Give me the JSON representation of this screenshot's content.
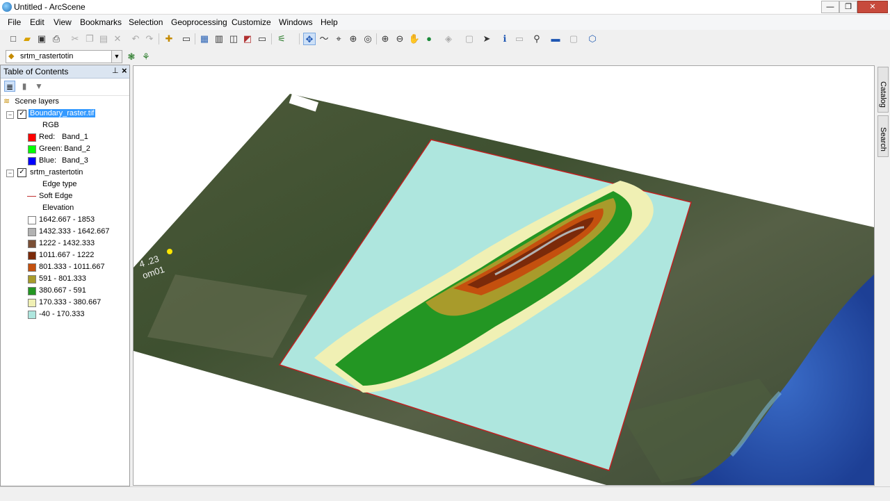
{
  "window": {
    "title": "Untitled - ArcScene",
    "minimize": "—",
    "maximize": "❐",
    "close": "✕"
  },
  "menu": [
    "File",
    "Edit",
    "View",
    "Bookmarks",
    "Selection",
    "Geoprocessing",
    "Customize",
    "Windows",
    "Help"
  ],
  "layer_dropdown": {
    "value": "srtm_rastertotin"
  },
  "toc": {
    "title": "Table of Contents",
    "group": "Scene layers",
    "layer1": {
      "name": "Boundary_raster.tif",
      "render": "RGB",
      "bands": [
        {
          "label": "Red:",
          "band": "Band_1",
          "color": "#ff0000"
        },
        {
          "label": "Green:",
          "band": "Band_2",
          "color": "#00ff00"
        },
        {
          "label": "Blue:",
          "band": "Band_3",
          "color": "#0000ff"
        }
      ]
    },
    "layer2": {
      "name": "srtm_rastertotin",
      "edge_heading": "Edge type",
      "edge_label": "Soft Edge",
      "elev_heading": "Elevation",
      "classes": [
        {
          "label": "1642.667 - 1853",
          "color": "#ffffff"
        },
        {
          "label": "1432.333 - 1642.667",
          "color": "#b2b2b2"
        },
        {
          "label": "1222 - 1432.333",
          "color": "#7a4f36"
        },
        {
          "label": "1011.667 - 1222",
          "color": "#7b2a0a"
        },
        {
          "label": "801.333 - 1011.667",
          "color": "#c4500e"
        },
        {
          "label": "591 - 801.333",
          "color": "#a89b2b"
        },
        {
          "label": "380.667 - 591",
          "color": "#239623"
        },
        {
          "label": "170.333 - 380.667",
          "color": "#f0f0b4"
        },
        {
          "label": "-40 - 170.333",
          "color": "#aee6de"
        }
      ]
    }
  },
  "scene": {
    "label_text": "om01",
    "label_numbers": "4 .23"
  },
  "dock": {
    "catalog": "Catalog",
    "search": "Search"
  }
}
